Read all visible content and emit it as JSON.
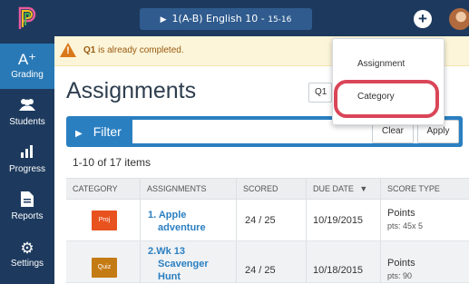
{
  "topbar": {
    "course_label": "1(A-B) English 10",
    "course_term": "15-16",
    "add_symbol": "+"
  },
  "sidebar": {
    "items": [
      {
        "label": "Grading",
        "icon": "A⁺",
        "icon_name": "grading-icon",
        "active": true
      },
      {
        "label": "Students",
        "icon": "👥",
        "icon_name": "students-icon",
        "active": false
      },
      {
        "label": "Progress",
        "icon": "📊",
        "icon_name": "progress-icon",
        "active": false
      },
      {
        "label": "Reports",
        "icon": "📄",
        "icon_name": "reports-icon",
        "active": false
      },
      {
        "label": "Settings",
        "icon": "⚙",
        "icon_name": "settings-icon",
        "active": false
      }
    ]
  },
  "alert": {
    "bold": "Q1",
    "text": " is already completed.",
    "icon": "warning-icon",
    "color": "#d9781a"
  },
  "page": {
    "title": "Assignments",
    "term_select": "Q1"
  },
  "filter": {
    "label": "Filter",
    "value": "",
    "placeholder": "",
    "clear_label": "Clear",
    "apply_label": "Apply"
  },
  "list": {
    "items_count": "1-10 of 17 items"
  },
  "table": {
    "columns": [
      "CATEGORY",
      "ASSIGNMENTS",
      "SCORED",
      "DUE DATE",
      "SCORE TYPE"
    ],
    "sort_indicator": "▼",
    "rows": [
      {
        "category": "Proj",
        "category_color": "#e8521e",
        "number": "1.",
        "name_lines": [
          "Apple",
          "adventure"
        ],
        "scored": "24 / 25",
        "due_date": "10/19/2015",
        "score_type": "Points",
        "pts": "pts: 45x 5"
      },
      {
        "category": "Quiz",
        "category_color": "#c57b14",
        "number": "2.",
        "name_lines": [
          "Wk 13",
          "Scavenger",
          "Hunt"
        ],
        "scored": "24 / 25",
        "due_date": "10/18/2015",
        "score_type": "Points",
        "pts": "pts: 90"
      }
    ]
  },
  "dropdown": {
    "items": [
      "Assignment",
      "Category"
    ],
    "highlight_color": "#d94658"
  },
  "colors": {
    "nav_bg": "#1d3a5e",
    "accent": "#2a7fc1",
    "alert_bg": "#fcf5d9"
  }
}
